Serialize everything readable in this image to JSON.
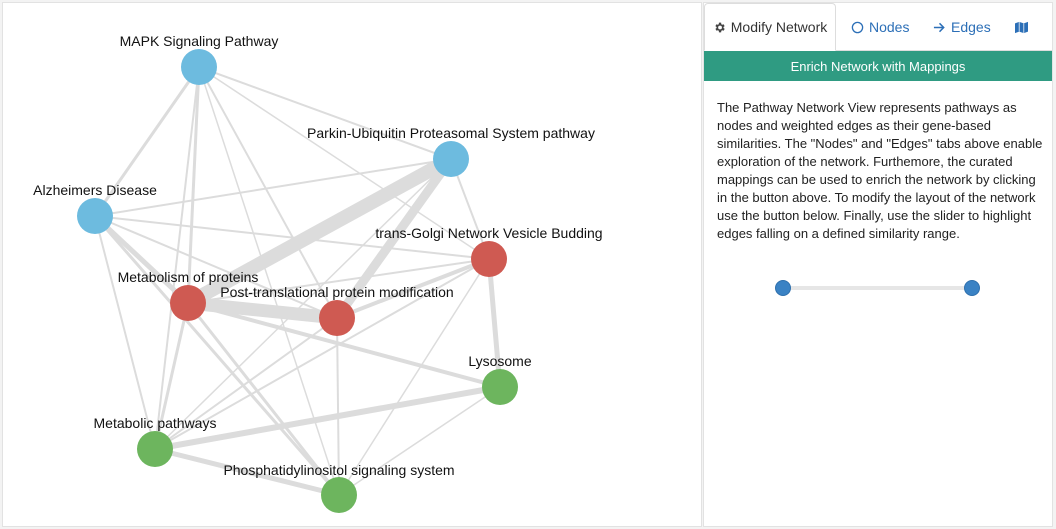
{
  "tabs": [
    {
      "label": "Modify Network",
      "icon": "gear-icon",
      "active": true
    },
    {
      "label": "Nodes",
      "icon": "circle-icon"
    },
    {
      "label": "Edges",
      "icon": "arrow-right-icon"
    },
    {
      "label": "",
      "icon": "map-icon"
    }
  ],
  "enrich_button_label": "Enrich Network with Mappings",
  "description": "The Pathway Network View represents pathways as nodes and weighted edges as their gene-based similarities. The \"Nodes\" and \"Edges\" tabs above enable exploration of the network. Furthemore, the curated mappings can be used to enrich the network by clicking in the button above. To modify the layout of the network use the button below. Finally, use the slider to highlight edges falling on a defined similarity range.",
  "colors": {
    "blue_node": "#6dbbdf",
    "red_node": "#cf5a52",
    "green_node": "#6db55e",
    "edge": "#dcdcdc",
    "accent": "#2f9b82",
    "slider": "#3a82c4"
  },
  "network": {
    "nodes": [
      {
        "id": "mapk",
        "label": "MAPK Signaling Pathway",
        "group": "blue"
      },
      {
        "id": "parkin",
        "label": "Parkin-Ubiquitin Proteasomal System pathway",
        "group": "blue"
      },
      {
        "id": "alz",
        "label": "Alzheimers Disease",
        "group": "blue"
      },
      {
        "id": "tgn",
        "label": "trans-Golgi Network Vesicle Budding",
        "group": "red"
      },
      {
        "id": "metprot",
        "label": "Metabolism of proteins",
        "group": "red"
      },
      {
        "id": "ptm",
        "label": "Post-translational protein modification",
        "group": "red"
      },
      {
        "id": "lyso",
        "label": "Lysosome",
        "group": "green"
      },
      {
        "id": "metpath",
        "label": "Metabolic pathways",
        "group": "green"
      },
      {
        "id": "pi",
        "label": "Phosphatidylinositol signaling system",
        "group": "green"
      }
    ],
    "edges": [
      {
        "source": "parkin",
        "target": "metprot",
        "weight": 14
      },
      {
        "source": "parkin",
        "target": "ptm",
        "weight": 9
      },
      {
        "source": "metprot",
        "target": "ptm",
        "weight": 13
      },
      {
        "source": "metpath",
        "target": "lyso",
        "weight": 6
      },
      {
        "source": "metpath",
        "target": "pi",
        "weight": 5
      },
      {
        "source": "tgn",
        "target": "lyso",
        "weight": 5
      },
      {
        "source": "alz",
        "target": "metprot",
        "weight": 5
      },
      {
        "source": "metprot",
        "target": "lyso",
        "weight": 4
      },
      {
        "source": "ptm",
        "target": "tgn",
        "weight": 4
      },
      {
        "source": "mapk",
        "target": "alz",
        "weight": 3
      },
      {
        "source": "mapk",
        "target": "metprot",
        "weight": 3
      },
      {
        "source": "mapk",
        "target": "parkin",
        "weight": 2
      },
      {
        "source": "alz",
        "target": "tgn",
        "weight": 2
      },
      {
        "source": "alz",
        "target": "parkin",
        "weight": 2
      },
      {
        "source": "alz",
        "target": "pi",
        "weight": 3
      },
      {
        "source": "alz",
        "target": "metpath",
        "weight": 2
      },
      {
        "source": "alz",
        "target": "ptm",
        "weight": 2
      },
      {
        "source": "mapk",
        "target": "ptm",
        "weight": 2
      },
      {
        "source": "mapk",
        "target": "pi",
        "weight": 1.5
      },
      {
        "source": "mapk",
        "target": "metpath",
        "weight": 2
      },
      {
        "source": "metprot",
        "target": "metpath",
        "weight": 3
      },
      {
        "source": "metprot",
        "target": "tgn",
        "weight": 2
      },
      {
        "source": "ptm",
        "target": "metpath",
        "weight": 2
      },
      {
        "source": "ptm",
        "target": "pi",
        "weight": 2
      },
      {
        "source": "tgn",
        "target": "metpath",
        "weight": 2
      },
      {
        "source": "tgn",
        "target": "pi",
        "weight": 1.5
      },
      {
        "source": "parkin",
        "target": "tgn",
        "weight": 2
      },
      {
        "source": "metprot",
        "target": "pi",
        "weight": 3
      },
      {
        "source": "lyso",
        "target": "pi",
        "weight": 1.5
      },
      {
        "source": "mapk",
        "target": "tgn",
        "weight": 1.5
      },
      {
        "source": "parkin",
        "target": "metpath",
        "weight": 1.5
      }
    ]
  }
}
